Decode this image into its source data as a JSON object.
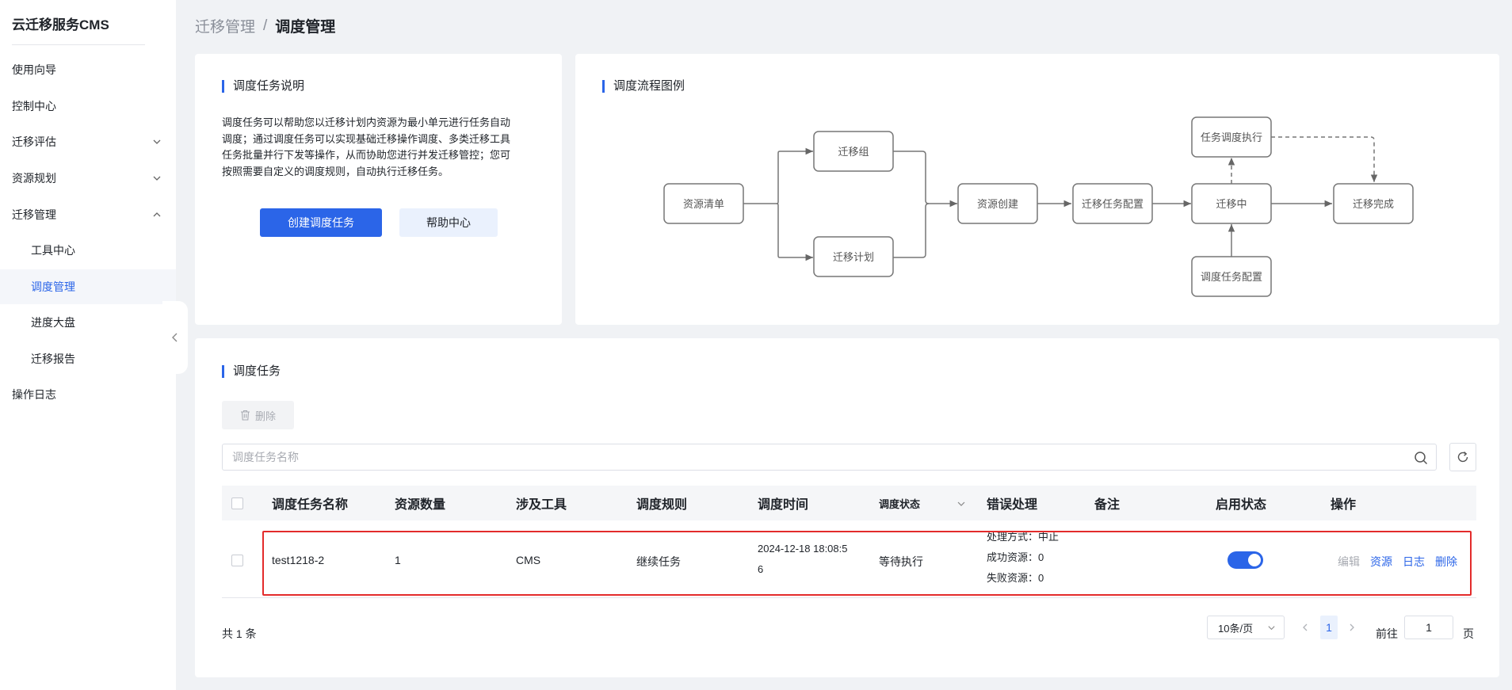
{
  "app": {
    "title": "云迁移服务CMS"
  },
  "sidebar": {
    "items": [
      {
        "label": "使用向导"
      },
      {
        "label": "控制中心"
      },
      {
        "label": "迁移评估"
      },
      {
        "label": "资源规划"
      },
      {
        "label": "迁移管理"
      },
      {
        "label": "工具中心"
      },
      {
        "label": "调度管理"
      },
      {
        "label": "进度大盘"
      },
      {
        "label": "迁移报告"
      },
      {
        "label": "操作日志"
      }
    ],
    "active_item": "调度管理"
  },
  "breadcrumb": {
    "parent": "迁移管理",
    "separator": "/",
    "current": "调度管理"
  },
  "intro": {
    "title": "调度任务说明",
    "lines": [
      "调度任务可以帮助您以迁移计划内资源为最小单元进行任务自动",
      "调度；通过调度任务可以实现基础迁移操作调度、多类迁移工具",
      "任务批量并行下发等操作，从而协助您进行并发迁移管控；您可",
      "按照需要自定义的调度规则，自动执行迁移任务。"
    ],
    "create_button": "创建调度任务",
    "help_button": "帮助中心"
  },
  "flow": {
    "title": "调度流程图例",
    "nodes": {
      "resource_list": "资源清单",
      "group": "迁移组",
      "plan": "迁移计划",
      "create": "资源创建",
      "task_config": "迁移任务配置",
      "migrating": "迁移中",
      "schedule_exec": "任务调度执行",
      "schedule_config": "调度任务配置",
      "done": "迁移完成"
    }
  },
  "tasks": {
    "title": "调度任务",
    "delete_button": "删除",
    "search_placeholder": "调度任务名称",
    "columns": [
      "调度任务名称",
      "资源数量",
      "涉及工具",
      "调度规则",
      "调度时间",
      "调度状态",
      "错误处理",
      "备注",
      "启用状态",
      "操作"
    ],
    "rows": [
      {
        "name": "test1218-2",
        "resource_count": "1",
        "tool": "CMS",
        "rule": "继续任务",
        "time_line1": "2024-12-18 18:08:5",
        "time_line2": "6",
        "status": "等待执行",
        "error_mode": "处理方式：中止",
        "success": "成功资源：0",
        "failed": "失败资源：0",
        "remark": "",
        "enabled": true,
        "ops": [
          "编辑",
          "资源",
          "日志",
          "删除"
        ]
      }
    ],
    "pagination": {
      "total": "共 1 条",
      "page_size": "10条/页",
      "current_page": "1",
      "goto_label": "前往",
      "goto_value": "1",
      "page_suffix": "页"
    }
  },
  "colors": {
    "accent": "#2b65e8",
    "highlight": "#e32b2b"
  }
}
